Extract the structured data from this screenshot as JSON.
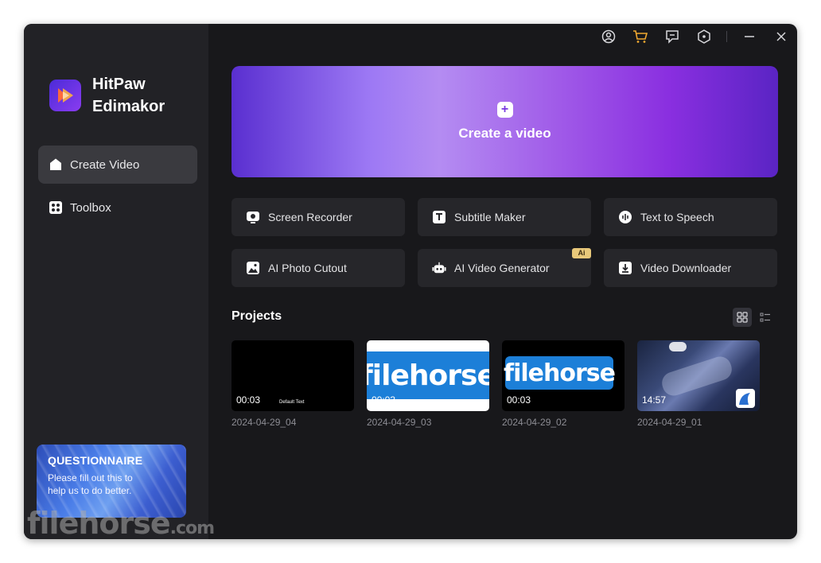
{
  "app": {
    "name": "HitPaw Edimakor"
  },
  "sidebar": {
    "items": [
      {
        "label": "Create Video",
        "icon": "home-icon",
        "active": true
      },
      {
        "label": "Toolbox",
        "icon": "toolbox-icon",
        "active": false
      }
    ],
    "questionnaire": {
      "title": "QUESTIONNAIRE",
      "text": "Please fill out this to help us to do better."
    }
  },
  "titlebar": {
    "icons": [
      "account-icon",
      "cart-icon",
      "feedback-icon",
      "settings-icon",
      "minimize-icon",
      "close-icon"
    ]
  },
  "hero": {
    "label": "Create a video",
    "gradient": [
      "#5a2fd0",
      "#b48cf2",
      "#8a2fe0"
    ]
  },
  "tools": [
    {
      "label": "Screen Recorder",
      "icon": "screen-recorder-icon"
    },
    {
      "label": "Subtitle Maker",
      "icon": "subtitle-icon"
    },
    {
      "label": "Text to Speech",
      "icon": "speech-icon"
    },
    {
      "label": "AI Photo Cutout",
      "icon": "photo-cutout-icon"
    },
    {
      "label": "AI Video Generator",
      "icon": "robot-icon",
      "badge": "Ai"
    },
    {
      "label": "Video Downloader",
      "icon": "download-icon"
    }
  ],
  "projects": {
    "title": "Projects",
    "items": [
      {
        "name": "2024-04-29_04",
        "duration": "00:03",
        "overlay_text": "Default Text"
      },
      {
        "name": "2024-04-29_03",
        "duration": "00:03"
      },
      {
        "name": "2024-04-29_02",
        "duration": "00:03"
      },
      {
        "name": "2024-04-29_01",
        "duration": "14:57"
      }
    ]
  },
  "watermark": {
    "text": "filehorse",
    "suffix": ".com"
  },
  "thumbnail_text": "filehorse"
}
